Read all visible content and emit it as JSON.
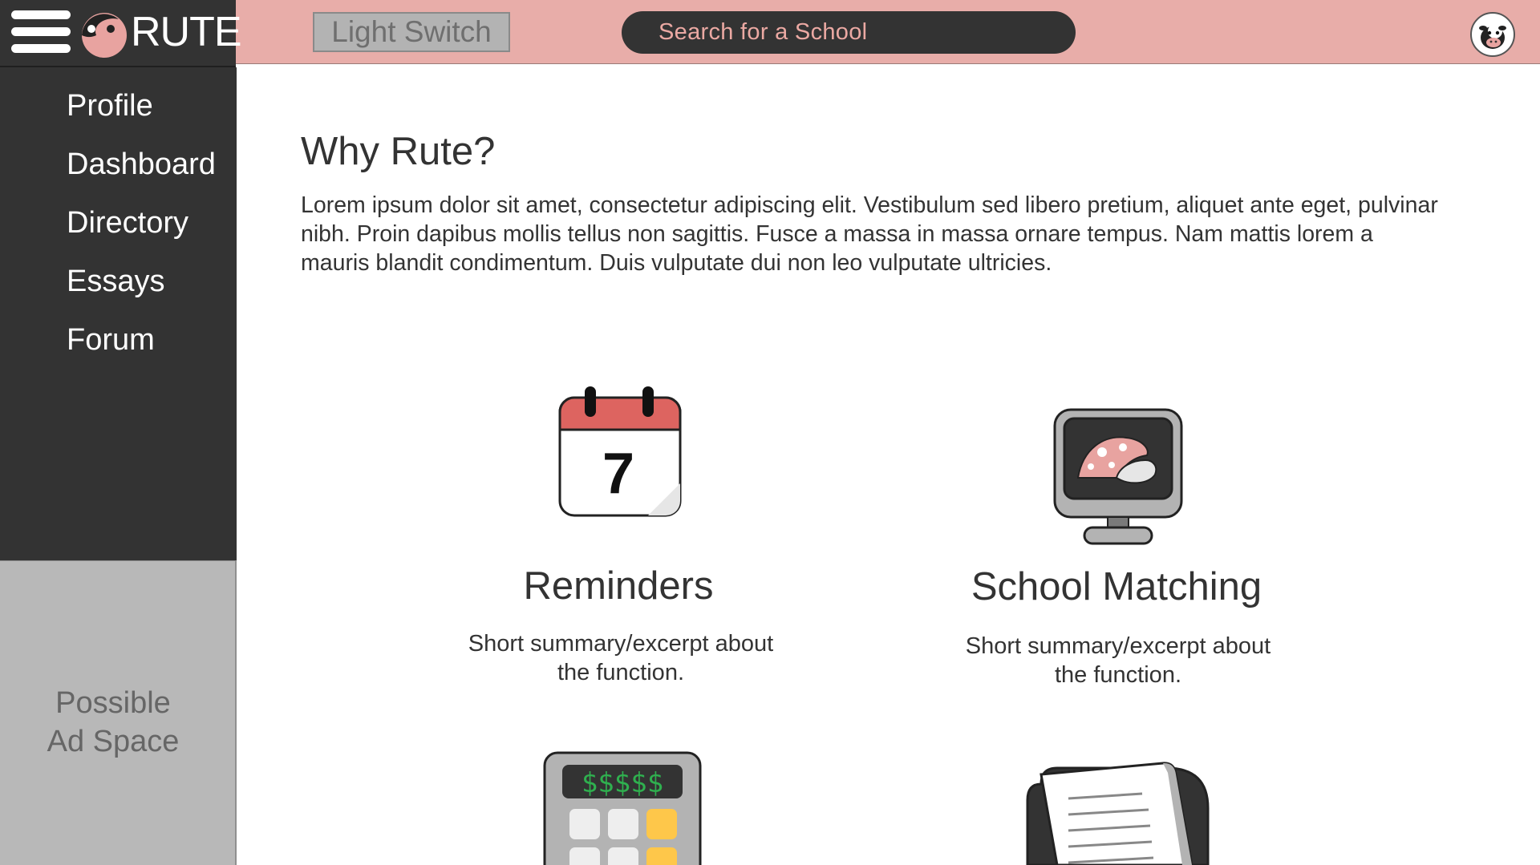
{
  "brand": {
    "name": "RUTE"
  },
  "header": {
    "light_switch_label": "Light Switch",
    "search_placeholder": "Search for a School"
  },
  "sidebar": {
    "items": [
      {
        "label": "Profile"
      },
      {
        "label": "Dashboard"
      },
      {
        "label": "Directory"
      },
      {
        "label": "Essays"
      },
      {
        "label": "Forum"
      }
    ],
    "ad_text_line1": "Possible",
    "ad_text_line2": "Ad Space"
  },
  "main": {
    "title": "Why Rute?",
    "intro": "Lorem ipsum dolor sit amet, consectetur adipiscing elit. Vestibulum sed libero pretium, aliquet ante eget, pulvinar nibh. Proin dapibus mollis tellus non sagittis. Fusce a massa in massa ornare tempus. Nam mattis lorem a mauris blandit condimentum. Duis vulputate dui non leo vulputate ultricies.",
    "features": [
      {
        "title": "Reminders",
        "summary": "Short summary/excerpt about the function.",
        "icon": "calendar-icon",
        "icon_text": "7"
      },
      {
        "title": "School Matching",
        "summary": "Short summary/excerpt about the function.",
        "icon": "monitor-mushroom-icon"
      },
      {
        "icon": "calculator-icon",
        "icon_text": "$$$$$"
      },
      {
        "icon": "document-icon"
      }
    ]
  },
  "colors": {
    "topbar": "#e8ada9",
    "dark": "#333333",
    "ad_gray": "#b8b8b8",
    "accent_red": "#dd6460",
    "calculator_green": "#2fb04f",
    "calculator_yellow": "#fec74a"
  }
}
